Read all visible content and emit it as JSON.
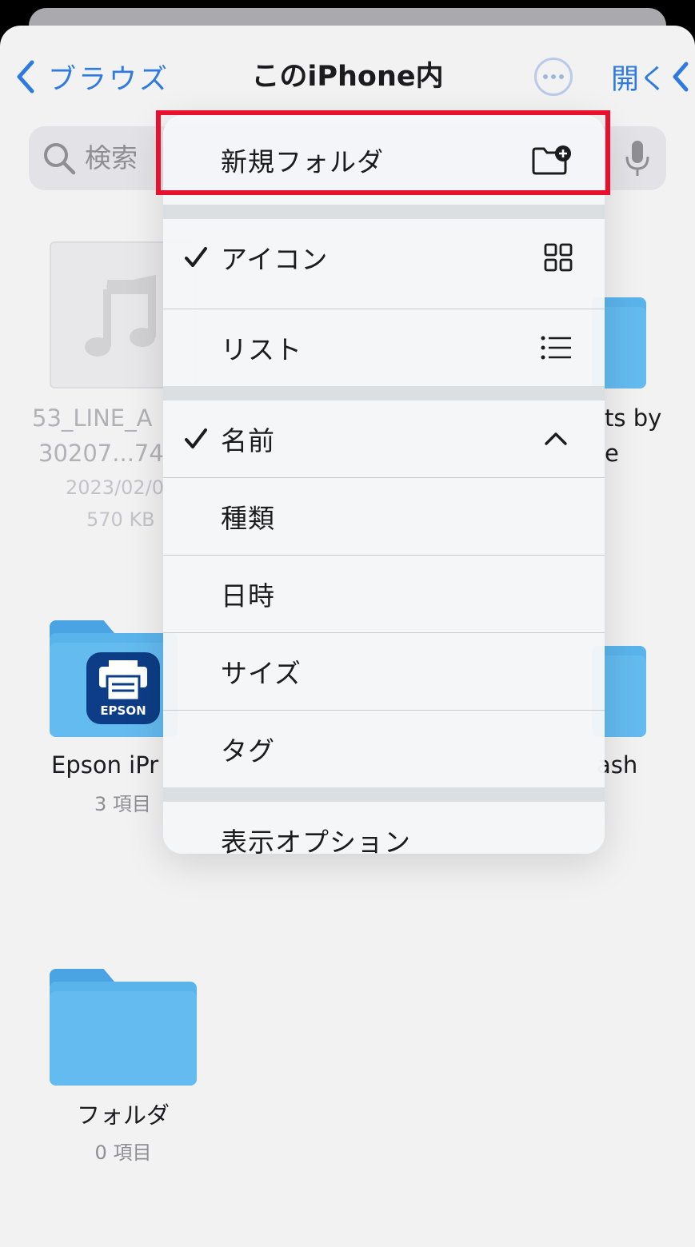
{
  "nav": {
    "back_label": "ブラウズ",
    "title": "このiPhone内",
    "open_label": "開く"
  },
  "search": {
    "placeholder": "検索"
  },
  "files": {
    "audio_file": {
      "name_line1": "53_LINE_A",
      "name_line2": "30207...74",
      "date": "2023/02/0",
      "size": "570 KB"
    },
    "right_folder_1": {
      "name_line1": "ts by",
      "name_line2": "e"
    },
    "epson_folder": {
      "name": "Epson iPr",
      "count": "3 項目",
      "app_label": "EPSON"
    },
    "right_folder_2": {
      "name": "ash"
    },
    "folder": {
      "name": "フォルダ",
      "count": "0 項目"
    }
  },
  "menu": {
    "new_folder": "新規フォルダ",
    "view": [
      {
        "label": "アイコン",
        "checked": true,
        "icon": "grid-icon"
      },
      {
        "label": "リスト",
        "checked": false,
        "icon": "list-icon"
      }
    ],
    "sort": [
      {
        "label": "名前",
        "checked": true,
        "icon": "chevron-up-icon"
      },
      {
        "label": "種類",
        "checked": false
      },
      {
        "label": "日時",
        "checked": false
      },
      {
        "label": "サイズ",
        "checked": false
      },
      {
        "label": "タグ",
        "checked": false
      }
    ],
    "view_options": "表示オプション"
  },
  "colors": {
    "accent": "#2f7ae0",
    "folder": "#5ab4ec",
    "highlight": "#e8112d"
  }
}
